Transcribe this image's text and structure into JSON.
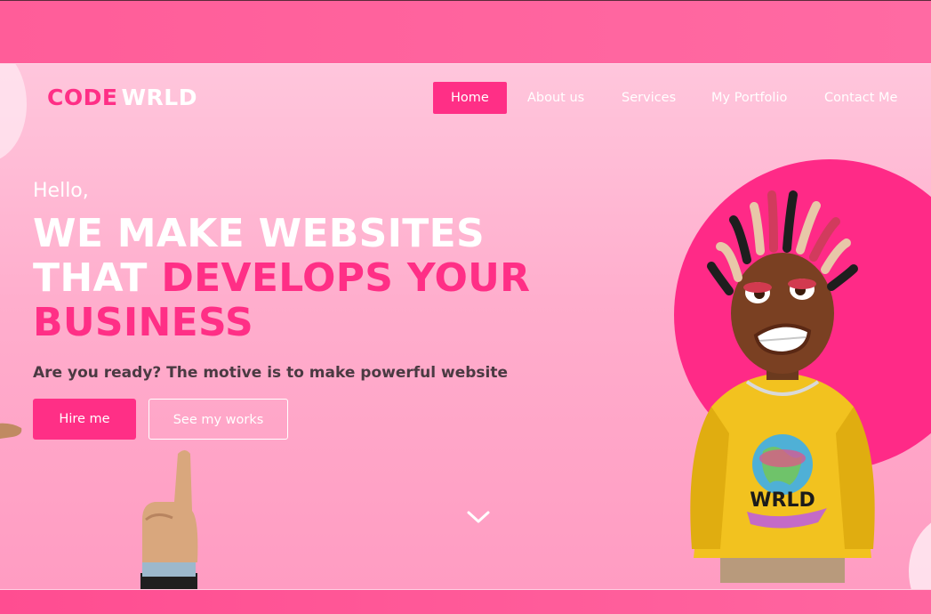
{
  "brand": {
    "part1": "CODE",
    "part2": "WRLD"
  },
  "nav": {
    "items": [
      {
        "label": "Home",
        "active": true
      },
      {
        "label": "About us"
      },
      {
        "label": "Services"
      },
      {
        "label": "My Portfolio"
      },
      {
        "label": "Contact Me"
      }
    ]
  },
  "hero": {
    "greeting": "Hello,",
    "headline_line1": "WE MAKE WEBSITES",
    "headline_line2_white": "THAT",
    "headline_line2_pink": "DEVELOPS YOUR",
    "headline_line3_pink": "BUSINESS",
    "subtitle": "Are you ready? The motive is to make powerful website",
    "primary_button": "Hire me",
    "secondary_button": "See my works",
    "shirt_text": "WRLD"
  },
  "colors": {
    "accent": "#ff2f86",
    "hero_bg": "#ffb3d0",
    "band": "#ff5f9c"
  },
  "icons": [
    "chevron-down-icon"
  ]
}
